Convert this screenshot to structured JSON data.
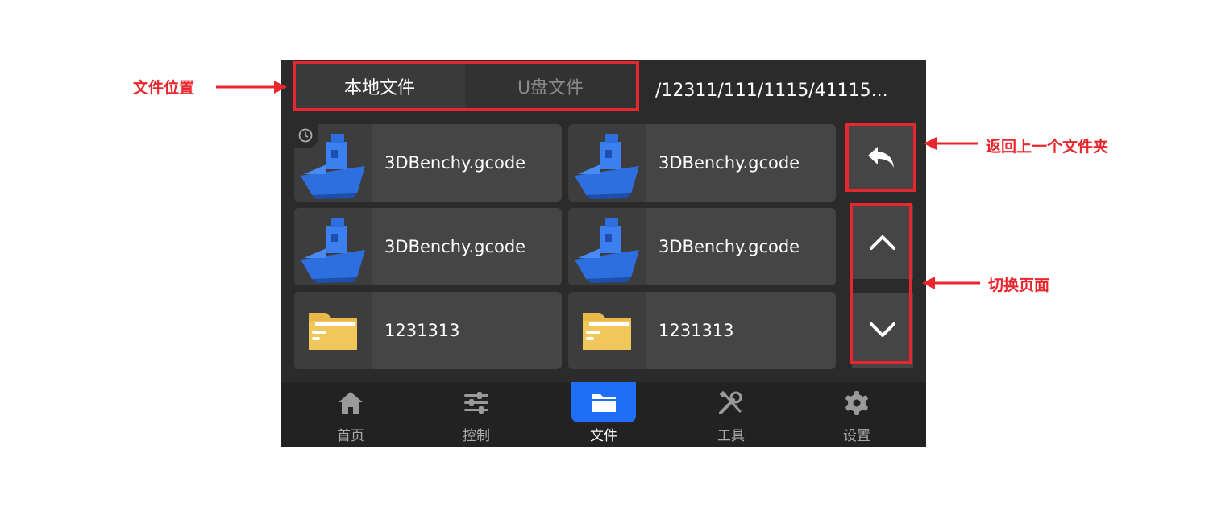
{
  "colors": {
    "background": "#2b2b2b",
    "card": "#454545",
    "accent": "#1f6ef5",
    "annotation": "#e8262d",
    "folder": "#f1c75c",
    "model": "#2e6fe0"
  },
  "tabs": [
    {
      "label": "本地文件",
      "active": true
    },
    {
      "label": "U盘文件",
      "active": false
    }
  ],
  "path": "/12311/111/1115/41115...",
  "files": [
    {
      "name": "3DBenchy.gcode",
      "icon": "boat-model-icon",
      "recent": true
    },
    {
      "name": "3DBenchy.gcode",
      "icon": "boat-model-icon",
      "recent": false
    },
    {
      "name": "3DBenchy.gcode",
      "icon": "boat-model-icon",
      "recent": false
    },
    {
      "name": "3DBenchy.gcode",
      "icon": "boat-model-icon",
      "recent": false
    },
    {
      "name": "1231313",
      "icon": "folder-icon",
      "recent": false
    },
    {
      "name": "1231313",
      "icon": "folder-icon",
      "recent": false
    }
  ],
  "side_buttons": {
    "back": "back-arrow-icon",
    "page_up": "chevron-up-icon",
    "page_down": "chevron-down-icon"
  },
  "nav": [
    {
      "label": "首页",
      "icon": "home-icon",
      "active": false
    },
    {
      "label": "控制",
      "icon": "sliders-icon",
      "active": false
    },
    {
      "label": "文件",
      "icon": "folder-icon",
      "active": true
    },
    {
      "label": "工具",
      "icon": "tools-icon",
      "active": false
    },
    {
      "label": "设置",
      "icon": "gear-icon",
      "active": false
    }
  ],
  "annotations": {
    "file_location": "文件位置",
    "back_folder": "返回上一个文件夹",
    "switch_page": "切换页面"
  }
}
